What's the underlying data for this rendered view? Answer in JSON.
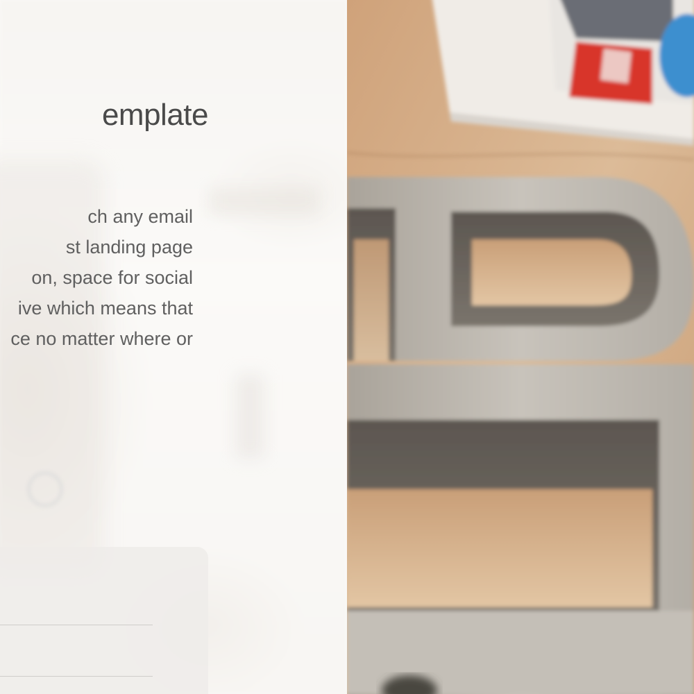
{
  "hero": {
    "title": "emplate",
    "description_lines": [
      "ch any email",
      "st landing page",
      "on, space for social",
      "ive which means that",
      "ce no matter where or"
    ]
  },
  "form": {
    "fields": [
      "",
      ""
    ]
  },
  "photo": {
    "subject": "concrete letter blocks on wooden surface"
  },
  "colors": {
    "text": "#4a4a4a",
    "body_text": "#5f5f5f",
    "card": "#eeece9",
    "wood": "#d7b48f",
    "concrete": "#bdb8b0"
  }
}
